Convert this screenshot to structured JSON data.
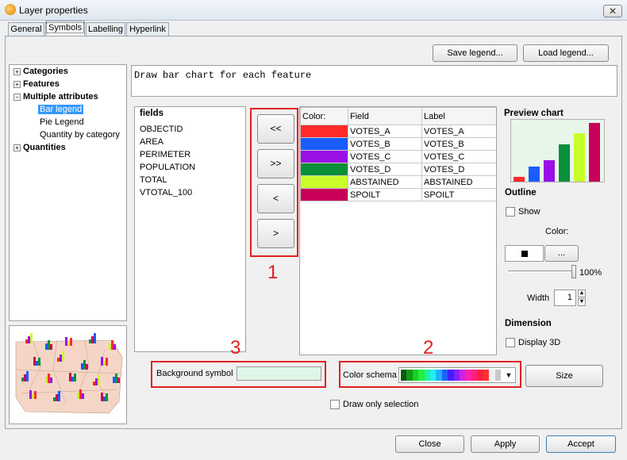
{
  "window": {
    "title": "Layer properties",
    "close_glyph": "✕"
  },
  "tabs": [
    {
      "label": "General"
    },
    {
      "label": "Symbols"
    },
    {
      "label": "Labelling"
    },
    {
      "label": "Hyperlink"
    }
  ],
  "toolbar": {
    "save_legend": "Save legend...",
    "load_legend": "Load legend..."
  },
  "description": "Draw bar chart for each feature",
  "tree": {
    "categories": "Categories",
    "features": "Features",
    "multiple_attributes": "Multiple attributes",
    "bar_legend": "Bar legend",
    "pie_legend": "Pie Legend",
    "quantity_by_category": "Quantity by category",
    "quantities": "Quantities",
    "expand_glyph": "+",
    "collapse_glyph": "−"
  },
  "fields": {
    "header": "fields",
    "items": [
      "OBJECTID",
      "AREA",
      "PERIMETER",
      "POPULATION",
      "TOTAL",
      "VTOTAL_100"
    ]
  },
  "move_buttons": {
    "all_left": "<<",
    "all_right": ">>",
    "left": "<",
    "right": ">"
  },
  "color_table": {
    "headers": [
      "Color:",
      "Field",
      "Label"
    ],
    "rows": [
      {
        "color": "#ff2a2a",
        "field": "VOTES_A",
        "label": "VOTES_A"
      },
      {
        "color": "#1a5cff",
        "field": "VOTES_B",
        "label": "VOTES_B"
      },
      {
        "color": "#9a10e6",
        "field": "VOTES_C",
        "label": "VOTES_C"
      },
      {
        "color": "#0a8f3a",
        "field": "VOTES_D",
        "label": "VOTES_D"
      },
      {
        "color": "#c8ff2a",
        "field": "ABSTAINED",
        "label": "ABSTAINED"
      },
      {
        "color": "#c8005a",
        "field": "SPOILT",
        "label": "SPOILT"
      }
    ]
  },
  "preview": {
    "title": "Preview chart",
    "bar_values": [
      0.08,
      0.26,
      0.36,
      0.63,
      0.82,
      1.0
    ]
  },
  "outline": {
    "title": "Outline",
    "show_label": "Show",
    "color_label": "Color:",
    "color_value": "#000000",
    "picker_button": "...",
    "opacity": "100%",
    "width_label": "Width",
    "width_value": "1"
  },
  "dimension": {
    "title": "Dimension",
    "display_3d": "Display 3D"
  },
  "background_symbol": {
    "label": "Background symbol",
    "color": "#dff5e8"
  },
  "color_schema": {
    "label": "Color schema",
    "swatches": [
      "#0a5a10",
      "#139b1a",
      "#1ad020",
      "#20f040",
      "#20f0a0",
      "#20f0f0",
      "#20b0ff",
      "#2060ff",
      "#4020ff",
      "#8020ff",
      "#d020e0",
      "#ff20b0",
      "#ff2080",
      "#ff2040",
      "#ff3030",
      "#f0f0f0",
      "#c8c8c8"
    ]
  },
  "size_button": "Size",
  "draw_only_selection": "Draw only selection",
  "annotations": [
    "1",
    "2",
    "3"
  ],
  "footer": {
    "close": "Close",
    "apply": "Apply",
    "accept": "Accept"
  }
}
